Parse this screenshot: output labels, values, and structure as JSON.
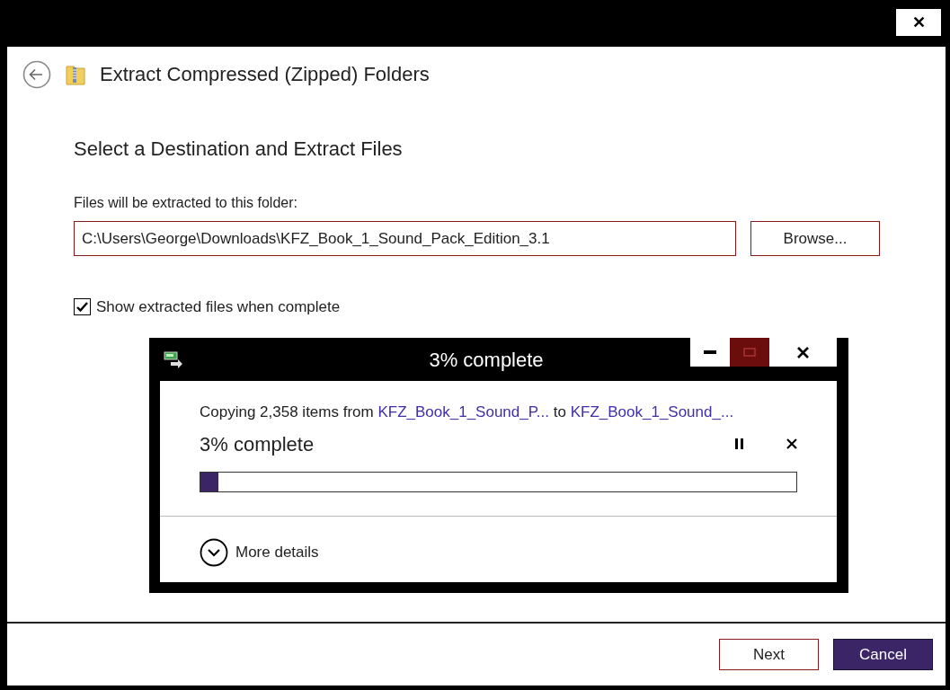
{
  "window": {
    "close_label": "✕"
  },
  "wizard": {
    "title": "Extract Compressed (Zipped) Folders",
    "heading": "Select a Destination and Extract Files",
    "field_label": "Files will be extracted to this folder:",
    "path": "C:\\Users\\George\\Downloads\\KFZ_Book_1_Sound_Pack_Edition_3.1",
    "browse_label": "Browse...",
    "show_files": {
      "label": "Show extracted files when complete",
      "checked": true
    }
  },
  "progress_dialog": {
    "title": "3% complete",
    "message": [
      {
        "kind": "text",
        "text": "Copying 2,358 items from "
      },
      {
        "kind": "link",
        "text": "KFZ_Book_1_Sound_P..."
      },
      {
        "kind": "text",
        "text": " to "
      },
      {
        "kind": "link",
        "text": "KFZ_Book_1_Sound_..."
      }
    ],
    "status": "3% complete",
    "level": 0.03,
    "details_label": "More details"
  },
  "buttons": [
    {
      "label": "Next",
      "kind": "outline"
    },
    {
      "label": "Cancel",
      "kind": "primary"
    }
  ]
}
